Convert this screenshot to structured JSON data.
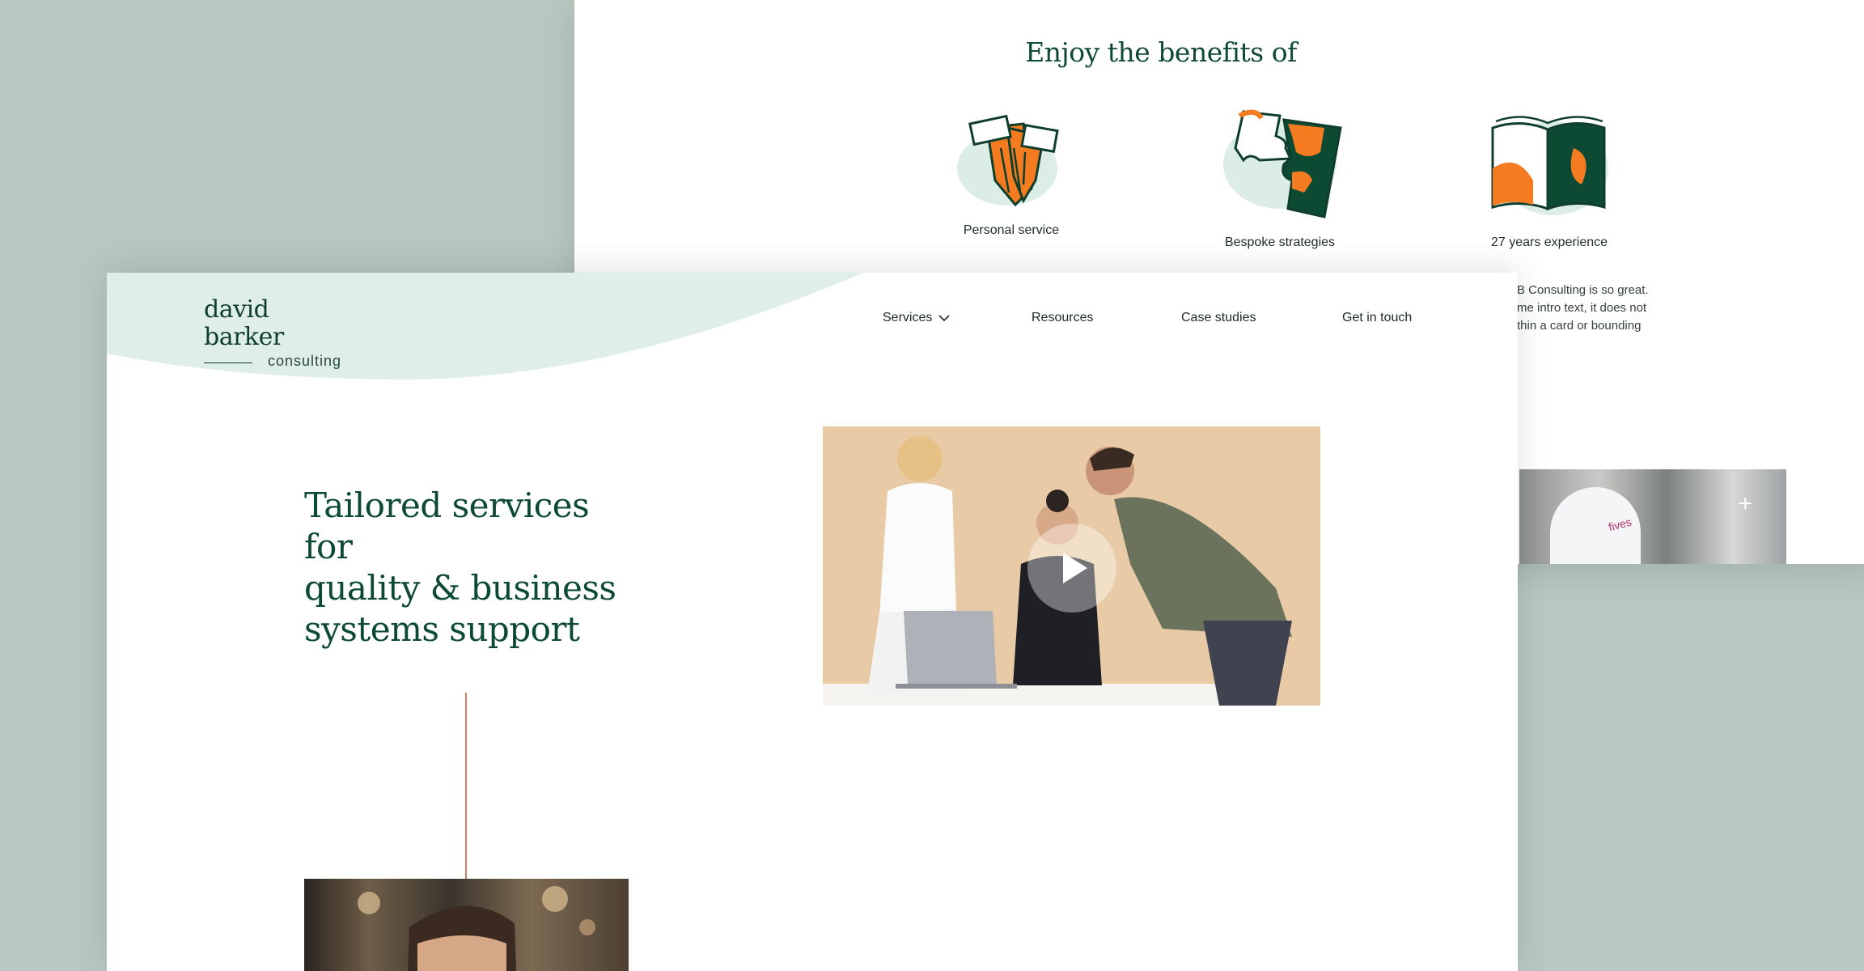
{
  "colors": {
    "background": "#b8c8c1",
    "brand_green": "#0d4a33",
    "accent_orange": "#f47b20",
    "header_wave": "#e0eeea",
    "accent_line": "#cf7f5d"
  },
  "benefits_page": {
    "title": "Enjoy the benefits of",
    "items": [
      {
        "label": "Personal service",
        "icon": "hands-icon"
      },
      {
        "label": "Bespoke strategies",
        "icon": "puzzle-icon"
      },
      {
        "label": "27 years experience",
        "icon": "book-icon"
      }
    ],
    "desc_lines": [
      "B Consulting is so great.",
      "me intro text, it does not",
      "thin a card or bounding"
    ]
  },
  "logo": {
    "name": "david barker",
    "sub": "consulting"
  },
  "nav": {
    "services": "Services",
    "resources": "Resources",
    "case_studies": "Case studies",
    "get_in_touch": "Get in touch"
  },
  "hero": {
    "title_lines": [
      "Tailored services for",
      "quality & business",
      "systems support"
    ]
  }
}
